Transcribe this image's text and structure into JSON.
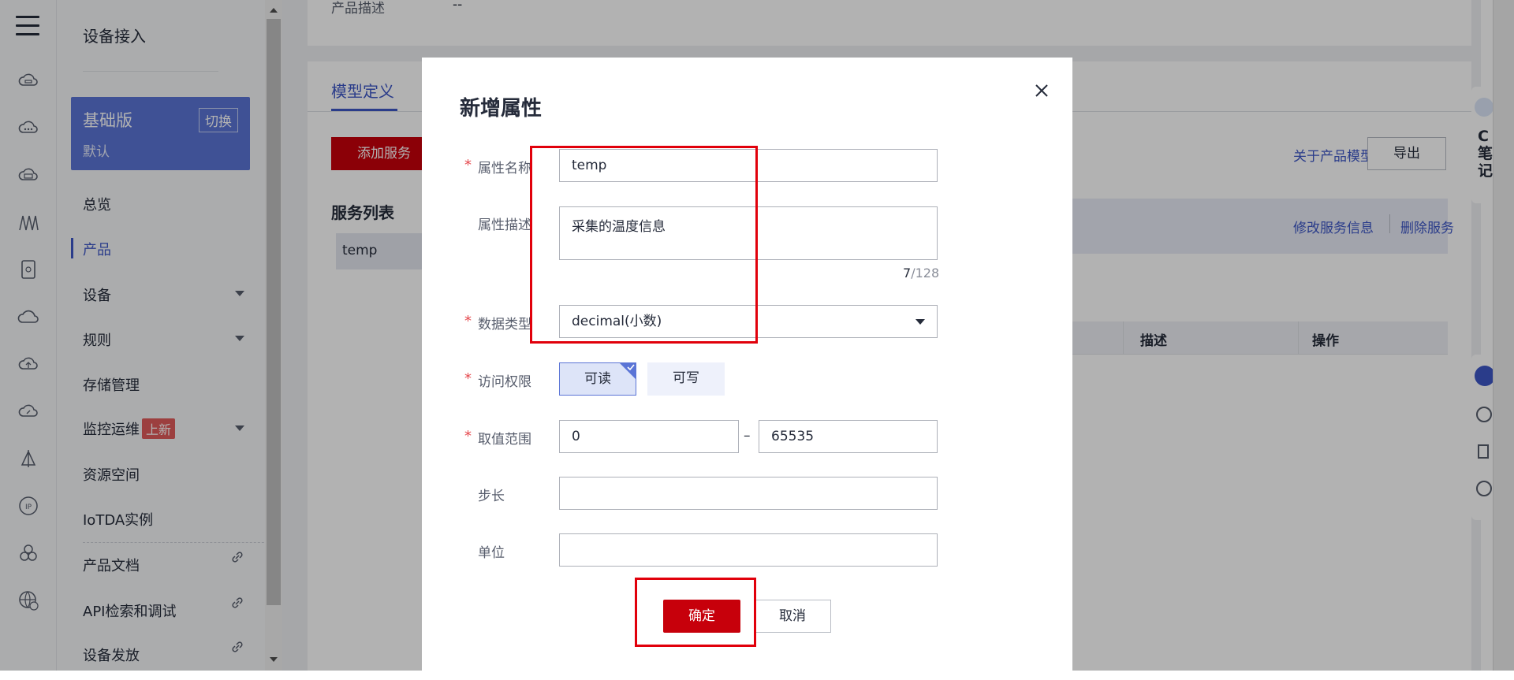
{
  "colors": {
    "brand_red": "#c7000b",
    "accent_blue": "#3d56c6",
    "card_blue": "#5b75d6"
  },
  "rail": {
    "icons": [
      "menu-icon",
      "cloud-device-icon",
      "cloud-dots-icon",
      "cloud-chip-icon",
      "waves-icon",
      "sim-card-icon",
      "cloud-icon",
      "cloud-upload-icon",
      "cloud-gauge-icon",
      "sailboat-icon",
      "ip-icon",
      "cluster-icon",
      "globe-w-icon"
    ]
  },
  "nav": {
    "title": "设备接入",
    "edition": {
      "name": "基础版",
      "switch": "切换",
      "sub": "默认"
    },
    "items": [
      {
        "label": "总览"
      },
      {
        "label": "产品"
      },
      {
        "label": "设备"
      },
      {
        "label": "规则"
      },
      {
        "label": "存储管理"
      },
      {
        "label": "监控运维",
        "badge": "上新"
      },
      {
        "label": "资源空间"
      },
      {
        "label": "IoTDA实例"
      },
      {
        "label": "产品文档"
      },
      {
        "label": "API检索和调试"
      },
      {
        "label": "设备发放"
      }
    ]
  },
  "page": {
    "product_desc_label": "产品描述",
    "product_desc_value": "--",
    "tab": "模型定义",
    "add_service": "添加服务",
    "service_list": "服务列表",
    "service_item": "temp",
    "about_model": "关于产品模型",
    "export": "导出",
    "edit_service": "修改服务信息",
    "delete_service": "删除服务",
    "col_desc": "描述",
    "col_ops": "操作",
    "side_text": "C笔记"
  },
  "dialog": {
    "title": "新增属性",
    "name_label": "属性名称",
    "name_value": "temp",
    "desc_label": "属性描述",
    "desc_value": "采集的温度信息",
    "desc_count": "7",
    "desc_max": "/128",
    "type_label": "数据类型",
    "type_value": "decimal(小数)",
    "access_label": "访问权限",
    "access_read": "可读",
    "access_write": "可写",
    "range_label": "取值范围",
    "range_min": "0",
    "range_dash": "–",
    "range_max": "65535",
    "step_label": "步长",
    "step_value": "",
    "unit_label": "单位",
    "unit_value": "",
    "required_mark": "*",
    "confirm": "确定",
    "cancel": "取消"
  }
}
